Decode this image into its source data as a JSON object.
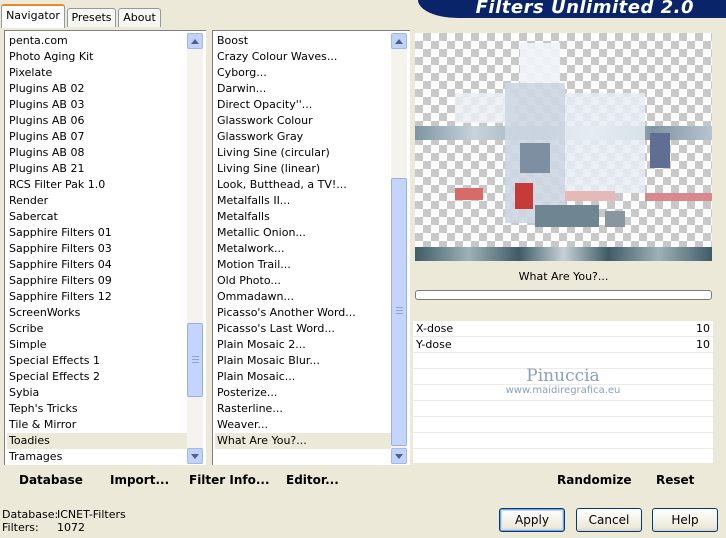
{
  "banner": {
    "title": "Filters Unlimited 2.0"
  },
  "tabs": [
    {
      "label": "Navigator",
      "active": true
    },
    {
      "label": "Presets",
      "active": false
    },
    {
      "label": "About",
      "active": false
    }
  ],
  "categories": {
    "items": [
      "penta.com",
      "Photo Aging Kit",
      "Pixelate",
      "Plugins AB 02",
      "Plugins AB 03",
      "Plugins AB 06",
      "Plugins AB 07",
      "Plugins AB 08",
      "Plugins AB 21",
      "RCS Filter Pak 1.0",
      "Render",
      "Sabercat",
      "Sapphire Filters 01",
      "Sapphire Filters 03",
      "Sapphire Filters 04",
      "Sapphire Filters 09",
      "Sapphire Filters 12",
      "ScreenWorks",
      "Scribe",
      "Simple",
      "Special Effects 1",
      "Special Effects 2",
      "Sybia",
      "Teph's Tricks",
      "Tile & Mirror",
      "Toadies",
      "Tramages"
    ],
    "selected": "Toadies"
  },
  "filters": {
    "items": [
      "Boost",
      "Crazy Colour Waves...",
      "Cyborg...",
      "Darwin...",
      "Direct Opacity''...",
      "Glasswork Colour",
      "Glasswork Gray",
      "Living Sine (circular)",
      "Living Sine (linear)",
      "Look, Butthead, a TV!...",
      "Metalfalls II...",
      "Metalfalls",
      "Metallic Onion...",
      "Metalwork...",
      "Motion Trail...",
      "Old Photo...",
      "Ommadawn...",
      "Picasso's Another Word...",
      "Picasso's Last Word...",
      "Plain Mosaic 2...",
      "Plain Mosaic Blur...",
      "Plain Mosaic...",
      "Posterize...",
      "Rasterline...",
      "Weaver...",
      "What Are You?..."
    ],
    "selected": "What Are You?..."
  },
  "preview": {
    "filter_name": "What Are You?..."
  },
  "params": [
    {
      "label": "X-dose",
      "value": "10"
    },
    {
      "label": "Y-dose",
      "value": "10"
    }
  ],
  "watermark": {
    "name": "Pinuccia",
    "url": "www.maidiregrafica.eu"
  },
  "toolbar": {
    "database": "Database",
    "import": "Import...",
    "filter_info": "Filter Info...",
    "editor": "Editor...",
    "randomize": "Randomize",
    "reset": "Reset"
  },
  "status": {
    "database_label": "Database:",
    "database_value": "ICNET-Filters",
    "filters_label": "Filters:",
    "filters_value": "1072"
  },
  "buttons": {
    "apply": "Apply",
    "cancel": "Cancel",
    "help": "Help"
  },
  "colors": {
    "banner": "#0a246a",
    "selection": "#ece9d8",
    "tab_accent": "#e68b2c",
    "dialog_bg": "#ece9d8"
  }
}
